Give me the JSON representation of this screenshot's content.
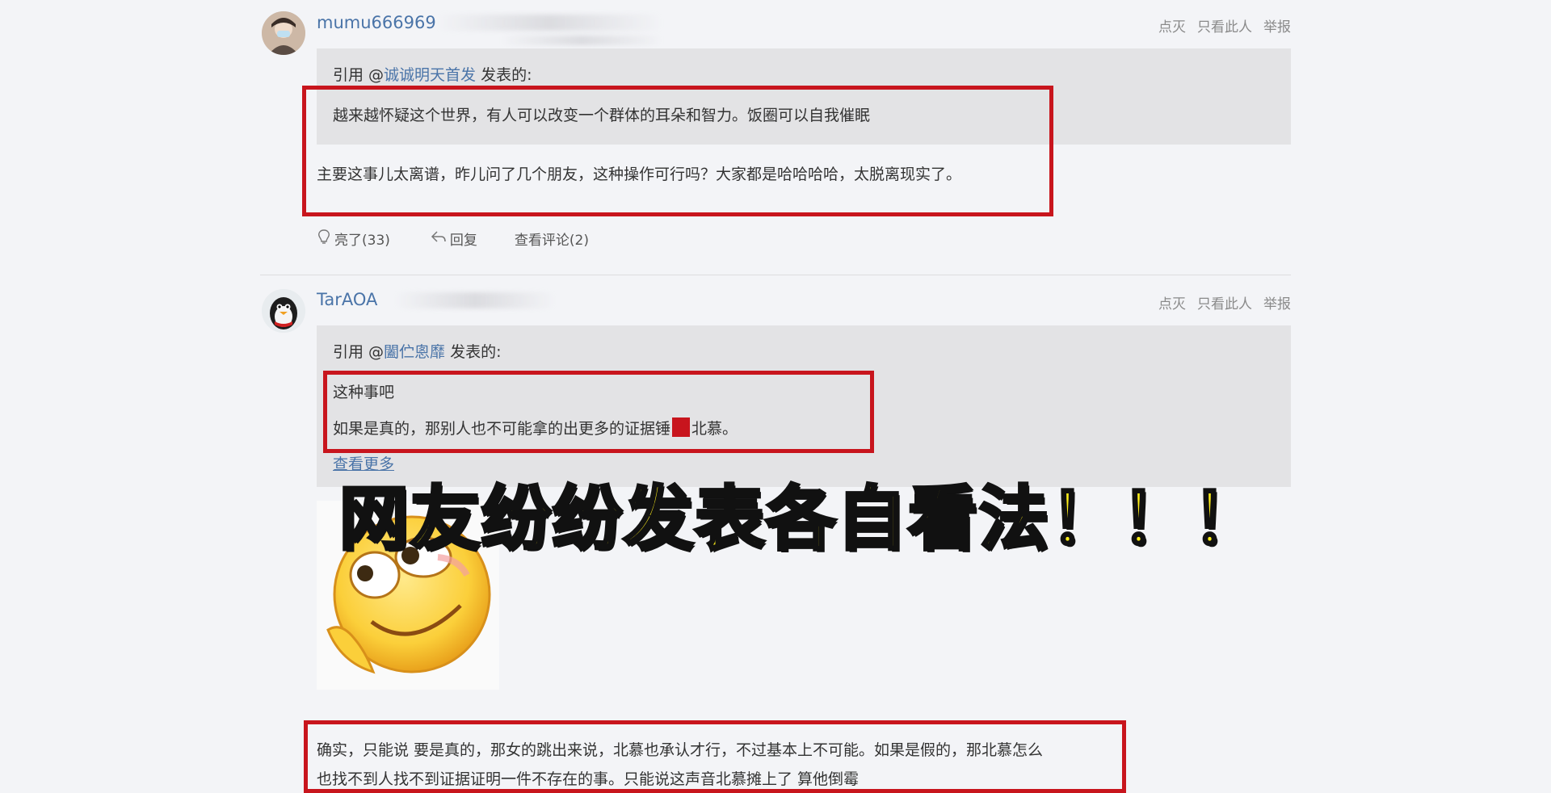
{
  "post1": {
    "username": "mumu666969",
    "actions": [
      "点灭",
      "只看此人",
      "举报"
    ],
    "quote_prefix": "引用 @",
    "quote_user": "诚诚明天首发",
    "quote_suffix": " 发表的:",
    "quote_text": "越来越怀疑这个世界，有人可以改变一个群体的耳朵和智力。饭圈可以自我催眠",
    "reply_text": "主要这事儿太离谱，昨儿问了几个朋友，这种操作可行吗？大家都是哈哈哈哈，太脱离现实了。",
    "like_label": "亮了(33)",
    "reply_label": "回复",
    "comments_label": "查看评论(2)"
  },
  "post2": {
    "username": "TarAOA",
    "actions": [
      "点灭",
      "只看此人",
      "举报"
    ],
    "quote_prefix": "引用 @",
    "quote_user": "闔伫悤靡",
    "quote_suffix": " 发表的:",
    "quote_line1": "这种事吧",
    "quote_line2_a": "如果是真的，那别人也不可能拿的出更多的证据锤",
    "quote_line2_b": "北慕。",
    "see_more": "查看更多",
    "reply_line1": "确实，只能说 要是真的，那女的跳出来说，北慕也承认才行，不过基本上不可能。如果是假的，那北慕怎么",
    "reply_line2": "也找不到人找不到证据证明一件不存在的事。只能说这声音北慕摊上了 算他倒霉"
  },
  "overlay": {
    "caption": "网友纷纷发表各自看法！！！"
  },
  "colors": {
    "accent_link": "#4a74a8",
    "highlight_red": "#c8151d",
    "caption_yellow": "#ffef1a"
  }
}
